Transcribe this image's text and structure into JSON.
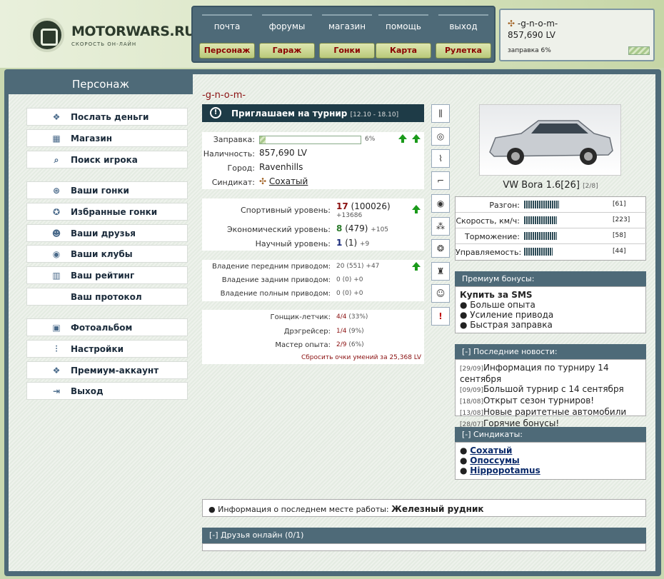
{
  "brand": {
    "name": "MOTORWARS.RU",
    "tagline": "СКОРОСТЬ ОН-ЛАЙН"
  },
  "nav": {
    "top": [
      "почта",
      "форумы",
      "магазин",
      "помощь",
      "выход"
    ],
    "buttons": [
      "Персонаж",
      "Гараж",
      "Гонки",
      "Карта",
      "Рулетка"
    ]
  },
  "user": {
    "name": "-g-n-o-m-",
    "money": "857,690 LV",
    "fuel_label": "заправка 6%",
    "fuel_percent": 6
  },
  "sidebar": {
    "title": "Персонаж",
    "items": [
      {
        "label": "Послать деньги",
        "icon": "money-icon"
      },
      {
        "label": "Магазин",
        "icon": "shop-icon"
      },
      {
        "label": "Поиск игрока",
        "icon": "search-icon"
      },
      {
        "label": "Ваши гонки",
        "icon": "steering-wheel-icon"
      },
      {
        "label": "Избранные гонки",
        "icon": "star-wheel-icon"
      },
      {
        "label": "Ваши друзья",
        "icon": "friends-icon"
      },
      {
        "label": "Ваши клубы",
        "icon": "clubs-icon"
      },
      {
        "label": "Ваш рейтинг",
        "icon": "rating-icon"
      },
      {
        "label": "Ваш протокол",
        "icon": ""
      },
      {
        "label": "Фотоальбом",
        "icon": "photo-icon"
      },
      {
        "label": "Настройки",
        "icon": "settings-icon"
      },
      {
        "label": "Премиум-аккаунт",
        "icon": "premium-icon"
      },
      {
        "label": "Выход",
        "icon": "exit-icon"
      }
    ]
  },
  "profile": {
    "name": "-g-n-o-m-",
    "invite": {
      "title": "Приглашаем на турнир",
      "dates": "[12.10 - 18.10]"
    },
    "info": {
      "fuel_label": "Заправка:",
      "fuel_value": "6%",
      "fuel_percent": 6,
      "cash_label": "Наличность:",
      "cash_value": "857,690 LV",
      "city_label": "Город:",
      "city_value": "Ravenhills",
      "syndicate_label": "Синдикат:",
      "syndicate_value": "Сохатый"
    },
    "levels": [
      {
        "label": "Спортивный уровень:",
        "level": "17",
        "points": "(100026)",
        "delta": "+13686",
        "color": "#8a1010"
      },
      {
        "label": "Экономический уровень:",
        "level": "8",
        "points": "(479)",
        "delta": "+105",
        "color": "#2a7a2a"
      },
      {
        "label": "Научный уровень:",
        "level": "1",
        "points": "(1)",
        "delta": "+9",
        "color": "#1a2a7a"
      }
    ],
    "drives": [
      {
        "label": "Владение передним приводом:",
        "value": "20",
        "points": "(551)",
        "delta": "+47"
      },
      {
        "label": "Владение задним приводом:",
        "value": "0",
        "points": "(0)",
        "delta": "+0"
      },
      {
        "label": "Владение полным приводом:",
        "value": "0",
        "points": "(0)",
        "delta": "+0"
      }
    ],
    "skills": [
      {
        "label": "Гонщик-летчик:",
        "value": "4/4",
        "pct": "(33%)"
      },
      {
        "label": "Дрэгрейсер:",
        "value": "1/4",
        "pct": "(9%)"
      },
      {
        "label": "Мастер опыта:",
        "value": "2/9",
        "pct": "(6%)"
      }
    ],
    "reset_link": "Сбросить очки умений за 25,368 LV"
  },
  "tuning_icons": [
    "shock-absorber-icon",
    "tire-icon",
    "exhaust-icon",
    "spoiler-icon",
    "brake-disc-icon",
    "camshaft-icon",
    "turbo-icon",
    "seat-icon",
    "driver-icon",
    "alert-icon"
  ],
  "car": {
    "name": "VW Bora 1.6[26]",
    "slot": "[2/8]",
    "stats": [
      {
        "label": "Разгон:",
        "value": "[61]",
        "level": 61
      },
      {
        "label": "Скорость, км/ч:",
        "value": "[223]",
        "level": 57
      },
      {
        "label": "Торможение:",
        "value": "[58]",
        "level": 58
      },
      {
        "label": "Управляемость:",
        "value": "[44]",
        "level": 50
      }
    ]
  },
  "premium": {
    "title": "Премиум бонусы:",
    "subtitle": "Купить за SMS",
    "items": [
      "Больше опыта",
      "Усиление привода",
      "Быстрая заправка"
    ]
  },
  "news": {
    "title": "[-]  Последние новости:",
    "items": [
      {
        "date": "[29/09]",
        "text": "Информация по турниру 14 сентября"
      },
      {
        "date": "[09/09]",
        "text": "Большой турнир с 14 сентября"
      },
      {
        "date": "[18/08]",
        "text": "Открыт сезон турниров!"
      },
      {
        "date": "[13/08]",
        "text": "Новые раритетные автомобили"
      },
      {
        "date": "[28/07]",
        "text": "Горячие бонусы!"
      }
    ]
  },
  "syndicates": {
    "title": "[-]  Синдикаты:",
    "items": [
      "Сохатый",
      "Опоссумы",
      "Hippopotamus"
    ]
  },
  "work": {
    "label": "Информация о последнем месте работы:",
    "value": "Железный рудник"
  },
  "friends": {
    "title": "[-]  Друзья онлайн (0/1)"
  }
}
